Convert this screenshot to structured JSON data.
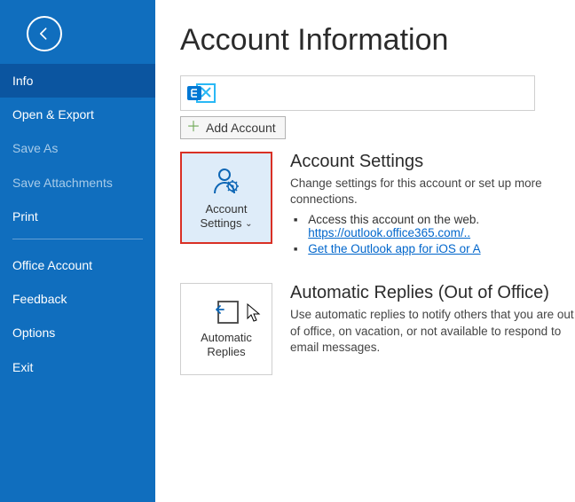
{
  "sidebar": {
    "items": [
      {
        "label": "Info",
        "state": "active"
      },
      {
        "label": "Open & Export",
        "state": "normal"
      },
      {
        "label": "Save As",
        "state": "disabled"
      },
      {
        "label": "Save Attachments",
        "state": "disabled"
      },
      {
        "label": "Print",
        "state": "normal"
      }
    ],
    "items2": [
      {
        "label": "Office Account"
      },
      {
        "label": "Feedback"
      },
      {
        "label": "Options"
      },
      {
        "label": "Exit"
      }
    ]
  },
  "main": {
    "title": "Account Information",
    "add_account": "Add Account",
    "account_settings": {
      "tile_line1": "Account",
      "tile_line2": "Settings",
      "heading": "Account Settings",
      "desc": "Change settings for this account or set up more connections.",
      "bullet1_text": "Access this account on the web.",
      "bullet1_link": "https://outlook.office365.com/..",
      "bullet2_link": "Get the Outlook app for iOS or A"
    },
    "auto_replies": {
      "tile_line1": "Automatic",
      "tile_line2": "Replies",
      "heading": "Automatic Replies (Out of Office)",
      "desc": "Use automatic replies to notify others that you are out of office, on vacation, or not available to respond to email messages."
    }
  }
}
